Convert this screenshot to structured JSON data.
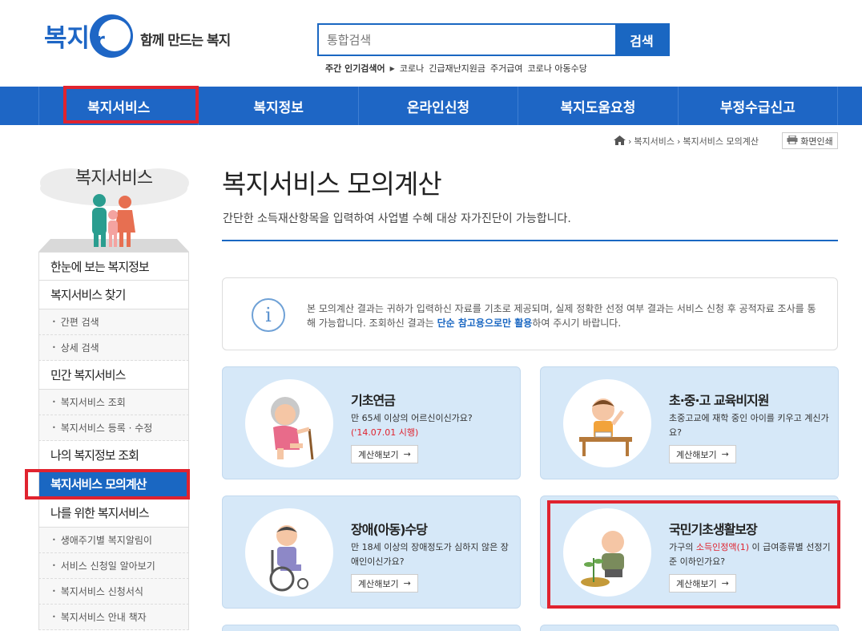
{
  "header": {
    "logo_text": "복지ro",
    "slogan": "함께 만드는 복지",
    "search_placeholder": "통합검색",
    "search_button": "검색",
    "popular_label": "주간 인기검색어",
    "popular_terms": [
      "코로나",
      "긴급재난지원금",
      "주거급여",
      "코로나 아동수당"
    ]
  },
  "gnb": [
    "복지서비스",
    "복지정보",
    "온라인신청",
    "복지도움요청",
    "부정수급신고"
  ],
  "breadcrumb": [
    "복지서비스",
    "복지서비스 모의계산"
  ],
  "print_label": "화면인쇄",
  "side": {
    "title": "복지서비스",
    "items": [
      {
        "label": "한눈에 보는 복지정보",
        "type": "main"
      },
      {
        "label": "복지서비스 찾기",
        "type": "main"
      },
      {
        "label": "간편 검색",
        "type": "sub"
      },
      {
        "label": "상세 검색",
        "type": "sub"
      },
      {
        "label": "민간 복지서비스",
        "type": "main"
      },
      {
        "label": "복지서비스 조회",
        "type": "sub"
      },
      {
        "label": "복지서비스 등록 · 수정",
        "type": "sub"
      },
      {
        "label": "나의 복지정보 조회",
        "type": "main"
      },
      {
        "label": "복지서비스 모의계산",
        "type": "active"
      },
      {
        "label": "나를 위한 복지서비스",
        "type": "main"
      },
      {
        "label": "생애주기별 복지알림이",
        "type": "sub"
      },
      {
        "label": "서비스 신청일 알아보기",
        "type": "sub"
      },
      {
        "label": "복지서비스 신청서식",
        "type": "sub"
      },
      {
        "label": "복지서비스 안내 책자",
        "type": "sub"
      }
    ]
  },
  "main": {
    "title": "복지서비스 모의계산",
    "desc": "간단한 소득재산항목을 입력하여 사업별 수혜 대상 자가진단이 가능합니다.",
    "notice_part1": "본 모의계산 결과는 귀하가 입력하신 자료를 기초로 제공되며, 실제 정확한 선정 여부 결과는 서비스 신청 후 공적자료 조사를 통해 가능합니다. 조회하신 결과는 ",
    "notice_em": "단순 참고용으로만 활용",
    "notice_part2": "하여 주시기 바랍니다.",
    "cards": [
      {
        "title": "기초연금",
        "desc": "만 65세 이상의 어르신이신가요?",
        "note": "('14.07.01 시행)",
        "button": "계산해보기"
      },
      {
        "title": "초·중·고 교육비지원",
        "desc": "초중고교에 재학 중인 아이를 키우고 계신가요?",
        "button": "계산해보기"
      },
      {
        "title": "장애(아동)수당",
        "desc": "만 18세 이상의 장애정도가 심하지 않은 장애인이신가요?",
        "button": "계산해보기"
      },
      {
        "title": "국민기초생활보장",
        "desc_pre": "가구의 ",
        "desc_red": "소득인정액(1)",
        "desc_post": " 이 급여종류별 선정기준 이하인가요?",
        "button": "계산해보기"
      }
    ]
  },
  "colors": {
    "primary": "#1e66c5",
    "highlight": "#e0232f",
    "card_bg": "#d6e8f8"
  }
}
